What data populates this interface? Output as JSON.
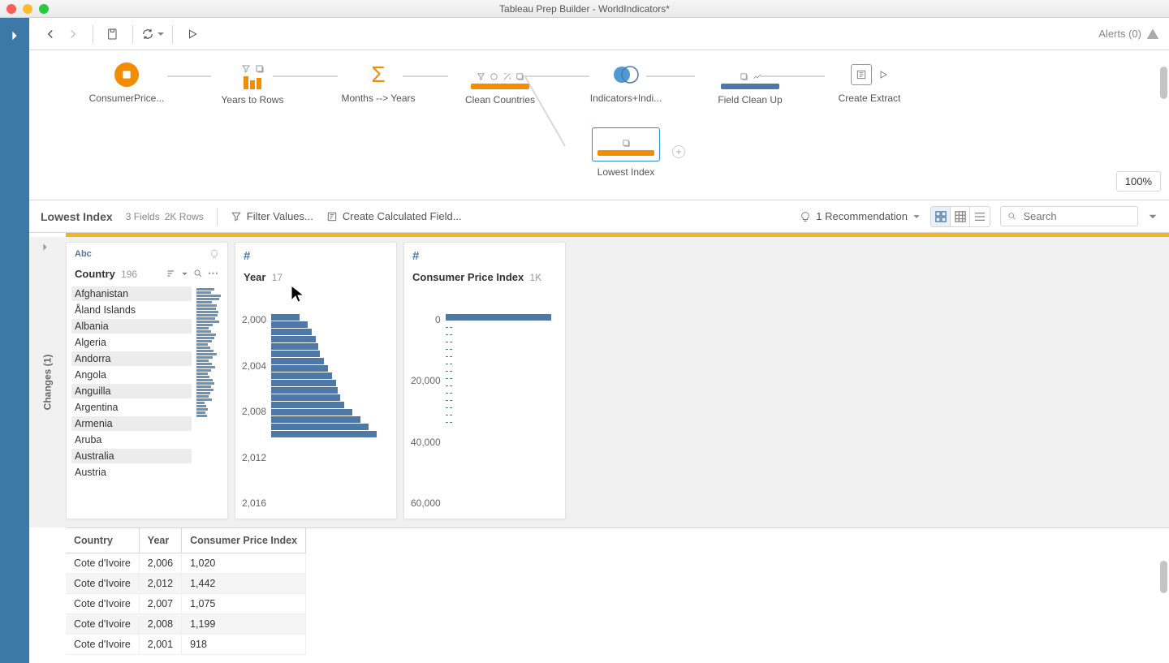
{
  "titlebar": {
    "title": "Tableau Prep Builder - WorldIndicators*"
  },
  "toolbar": {
    "alerts_label": "Alerts (0)"
  },
  "flow": {
    "zoom": "100%",
    "nodes": {
      "n1": {
        "label": "ConsumerPrice..."
      },
      "n2": {
        "label": "Years to Rows"
      },
      "n3": {
        "label": "Months --> Years"
      },
      "n4": {
        "label": "Clean Countries"
      },
      "n5": {
        "label": "Indicators+Indi..."
      },
      "n6": {
        "label": "Field Clean Up"
      },
      "n7": {
        "label": "Create Extract"
      },
      "n8": {
        "label": "Lowest Index"
      }
    }
  },
  "step": {
    "name": "Lowest Index",
    "fields": "3 Fields",
    "rows": "2K Rows",
    "filter": "Filter Values...",
    "calc": "Create Calculated Field...",
    "rec": "1 Recommendation",
    "search_placeholder": "Search",
    "changes_label": "Changes (1)"
  },
  "profiles": {
    "country": {
      "type": "Abc",
      "title": "Country",
      "count": "196",
      "values": [
        "Afghanistan",
        "Åland Islands",
        "Albania",
        "Algeria",
        "Andorra",
        "Angola",
        "Anguilla",
        "Argentina",
        "Armenia",
        "Aruba",
        "Australia",
        "Austria"
      ],
      "mini_widths": [
        22,
        18,
        30,
        28,
        19,
        25,
        24,
        27,
        26,
        23,
        28,
        20,
        15,
        18,
        24,
        22,
        19,
        14,
        17,
        21,
        25,
        20,
        15,
        19,
        23,
        18,
        14,
        16,
        20,
        22,
        18,
        21,
        17,
        15,
        19,
        10,
        12,
        14,
        11,
        13
      ]
    },
    "year": {
      "type": "#",
      "title": "Year",
      "count": "17",
      "axis": [
        "2,000",
        "2,004",
        "2,008",
        "2,012",
        "2,016"
      ],
      "bars": [
        35,
        45,
        50,
        55,
        58,
        60,
        65,
        70,
        75,
        80,
        82,
        85,
        90,
        100,
        110,
        120,
        130
      ]
    },
    "cpi": {
      "type": "#",
      "title": "Consumer Price Index",
      "count": "1K",
      "axis": [
        "0",
        "20,000",
        "40,000",
        "60,000"
      ]
    }
  },
  "table": {
    "headers": [
      "Country",
      "Year",
      "Consumer Price Index"
    ],
    "rows": [
      [
        "Cote d'Ivoire",
        "2,006",
        "1,020"
      ],
      [
        "Cote d'Ivoire",
        "2,012",
        "1,442"
      ],
      [
        "Cote d'Ivoire",
        "2,007",
        "1,075"
      ],
      [
        "Cote d'Ivoire",
        "2,008",
        "1,199"
      ],
      [
        "Cote d'Ivoire",
        "2,001",
        "918"
      ]
    ]
  },
  "chart_data": [
    {
      "type": "bar",
      "orientation": "horizontal",
      "title": "Year",
      "categories": [
        2000,
        2001,
        2002,
        2003,
        2004,
        2005,
        2006,
        2007,
        2008,
        2009,
        2010,
        2011,
        2012,
        2013,
        2014,
        2015,
        2016
      ],
      "values": [
        35,
        45,
        50,
        55,
        58,
        60,
        65,
        70,
        75,
        80,
        82,
        85,
        90,
        100,
        110,
        120,
        130
      ],
      "ylabel": "Year",
      "xlim": [
        0,
        140
      ]
    },
    {
      "type": "bar",
      "orientation": "horizontal",
      "title": "Consumer Price Index",
      "categories": [
        "0",
        "20,000",
        "40,000",
        "60,000"
      ],
      "values": [
        130,
        2,
        1,
        1
      ],
      "ylabel": "CPI",
      "xlim": [
        0,
        140
      ]
    }
  ]
}
